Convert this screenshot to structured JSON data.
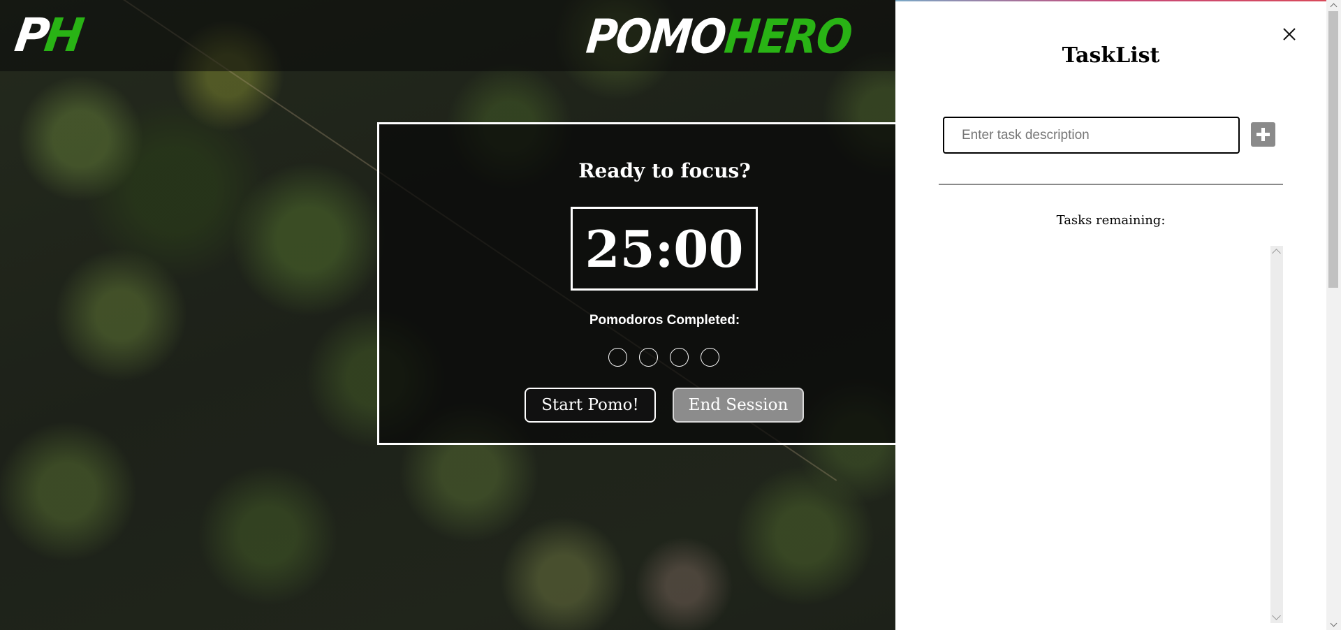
{
  "header": {
    "logo_p": "P",
    "logo_h": "H",
    "brand_first": "POMO",
    "brand_second": "HERO"
  },
  "timer": {
    "heading": "Ready to focus?",
    "time": "25:00",
    "completed_label": "Pomodoros Completed:",
    "pomodoro_slots": 4,
    "pomodoros_completed": 0,
    "start_label": "Start Pomo!",
    "end_label": "End Session"
  },
  "tasklist": {
    "title": "TaskList",
    "input_placeholder": "Enter task description",
    "input_value": "",
    "remaining_label": "Tasks remaining:",
    "tasks": []
  },
  "icons": {
    "close": "close-icon",
    "add": "plus-icon"
  },
  "colors": {
    "brand_green": "#29b315",
    "end_button_bg": "#8c8c8c",
    "add_button_bg": "#8a8a8a"
  }
}
